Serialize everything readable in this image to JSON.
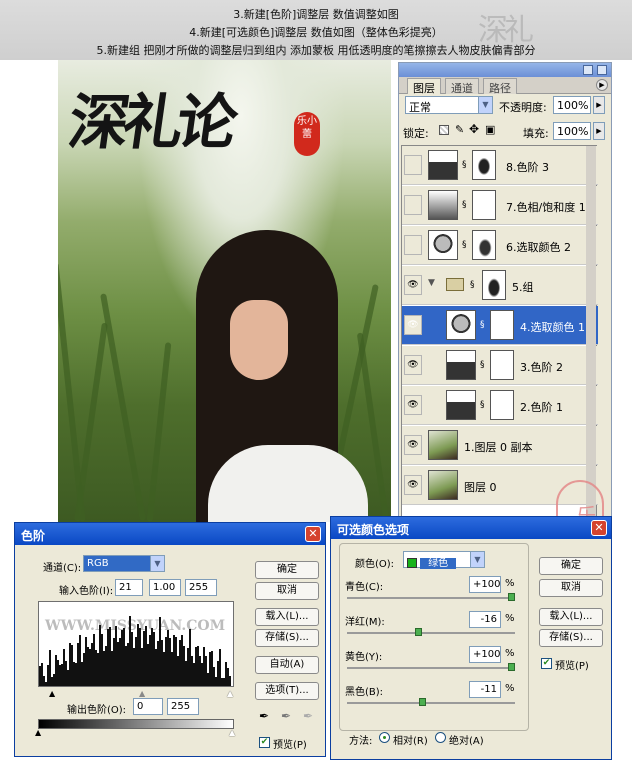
{
  "header": {
    "lines": [
      "3.新建[色阶]调整层 数值调整如图",
      "4.新建[可选颜色]调整层 数值如图（整体色彩提亮）",
      "5.新建组 把刚才所做的调整层归到组内 添加蒙板 用低透明度的笔擦擦去人物皮肤偏青部分"
    ],
    "seal_text": "深礼"
  },
  "photo": {
    "calligraphy": "深礼论",
    "red_seal": "乐小蕾"
  },
  "layers_panel": {
    "tabs": [
      "图层",
      "通道",
      "路径"
    ],
    "blend_mode": "正常",
    "opacity_label": "不透明度:",
    "opacity_value": "100%",
    "lock_label": "锁定:",
    "fill_label": "填充:",
    "fill_value": "100%",
    "layers": [
      {
        "name": "8.色阶 3",
        "visible": false,
        "type": "levels"
      },
      {
        "name": "7.色相/饱和度 1",
        "visible": false,
        "type": "hue"
      },
      {
        "name": "6.选取颜色 2",
        "visible": false,
        "type": "selective"
      },
      {
        "name": "5.组",
        "visible": true,
        "type": "group"
      },
      {
        "name": "4.选取颜色 1",
        "visible": true,
        "type": "selective",
        "selected": true
      },
      {
        "name": "3.色阶 2",
        "visible": true,
        "type": "levels"
      },
      {
        "name": "2.色阶 1",
        "visible": true,
        "type": "levels"
      },
      {
        "name": "1.图层 0 副本",
        "visible": true,
        "type": "image"
      },
      {
        "name": "图层 0",
        "visible": true,
        "type": "image"
      }
    ]
  },
  "levels_dialog": {
    "title": "色阶",
    "channel_label": "通道(C):",
    "channel_value": "RGB",
    "input_label": "输入色阶(I):",
    "input_values": [
      "21",
      "1.00",
      "255"
    ],
    "output_label": "输出色阶(O):",
    "output_values": [
      "0",
      "255"
    ],
    "watermark": "WWW.MISSYUAN.COM",
    "buttons": [
      "确定",
      "取消",
      "载入(L)...",
      "存储(S)...",
      "自动(A)",
      "选项(T)..."
    ],
    "preview_label": "预览(P)",
    "preview_checked": true
  },
  "selective_dialog": {
    "title": "可选颜色选项",
    "color_label": "颜色(O):",
    "color_value": "绿色",
    "sliders": [
      {
        "label": "青色(C):",
        "value": "+100",
        "fraction": 1.0
      },
      {
        "label": "洋红(M):",
        "value": "-16",
        "fraction": 0.42
      },
      {
        "label": "黄色(Y):",
        "value": "+100",
        "fraction": 1.0
      },
      {
        "label": "黑色(B):",
        "value": "-11",
        "fraction": 0.445
      }
    ],
    "unit": "%",
    "method_label": "方法:",
    "method_relative": "相对(R)",
    "method_absolute": "绝对(A)",
    "method_selected": "relative",
    "buttons": [
      "确定",
      "取消",
      "载入(L)...",
      "存储(S)..."
    ],
    "preview_label": "预览(P)",
    "preview_checked": true
  },
  "side_seal": "乐小蕾"
}
